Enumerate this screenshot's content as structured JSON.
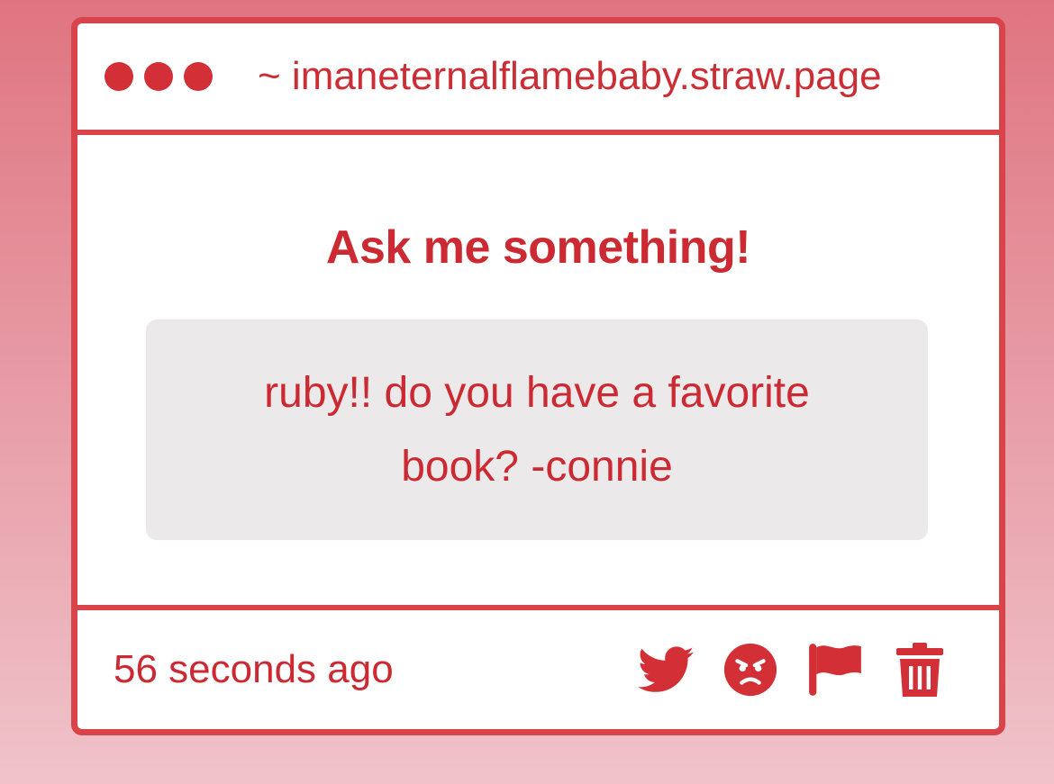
{
  "window": {
    "url": "~ imaneternalflamebaby.straw.page"
  },
  "main": {
    "heading": "Ask me something!",
    "question": "ruby!! do you have a favorite book? -connie"
  },
  "footer": {
    "timestamp": "56 seconds ago",
    "actions": [
      {
        "icon": "twitter-icon"
      },
      {
        "icon": "angry-face-icon"
      },
      {
        "icon": "flag-icon"
      },
      {
        "icon": "trash-icon"
      }
    ]
  },
  "colors": {
    "accent": "#d22f36",
    "border": "#d9434a",
    "bubble": "#ece9eb"
  }
}
